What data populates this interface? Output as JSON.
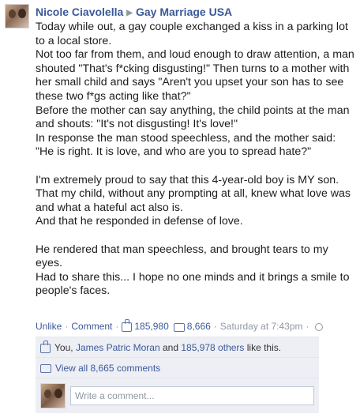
{
  "post": {
    "author": "Nicole Ciavolella",
    "arrow": "▶",
    "target": "Gay Marriage USA",
    "paragraphs": [
      "Today while out, a gay couple exchanged a kiss in a parking lot to a local store.",
      "Not too far from them, and loud enough to draw attention, a man shouted \"That's f*cking disgusting!\" Then turns to a mother with her small child and says \"Aren't you upset your son has to see these two f*gs acting like that?\"",
      "Before the mother can say anything, the child points at the man and shouts: \"It's not disgusting! It's love!\"",
      "In response the man stood speechless, and the mother said: \"He is right. It is love, and who are you to spread hate?\"",
      "",
      "I'm extremely proud to say that this 4-year-old boy is MY son.",
      "That my child, without any prompting at all, knew what love was and what a hateful act also is.",
      "And that he responded in defense of love.",
      "",
      "He rendered that man speechless, and brought tears to my eyes.",
      "Had to share this... I hope no one minds and it brings a smile to people's faces."
    ]
  },
  "actions": {
    "unlike": "Unlike",
    "sep1": "·",
    "comment": "Comment",
    "sep2": "·",
    "likes_count": "185,980",
    "comments_count": "8,666",
    "sep3": "·",
    "timestamp": "Saturday at 7:43pm",
    "sep4": "·"
  },
  "ufi": {
    "likes_prefix": "You, ",
    "liker": "James Patric Moran",
    "and": " and ",
    "others": "185,978 others",
    "like_suffix": " like this.",
    "view_all": "View all 8,665 comments",
    "comment_placeholder": "Write a comment..."
  },
  "icons": {
    "like": "thumbs-up-icon",
    "comment": "comment-bubble-icon",
    "audience": "globe-icon",
    "separator": "triangle-right-icon"
  },
  "colors": {
    "link": "#3b5998",
    "muted": "#9197a3",
    "ufi_bg": "#edeff4"
  }
}
